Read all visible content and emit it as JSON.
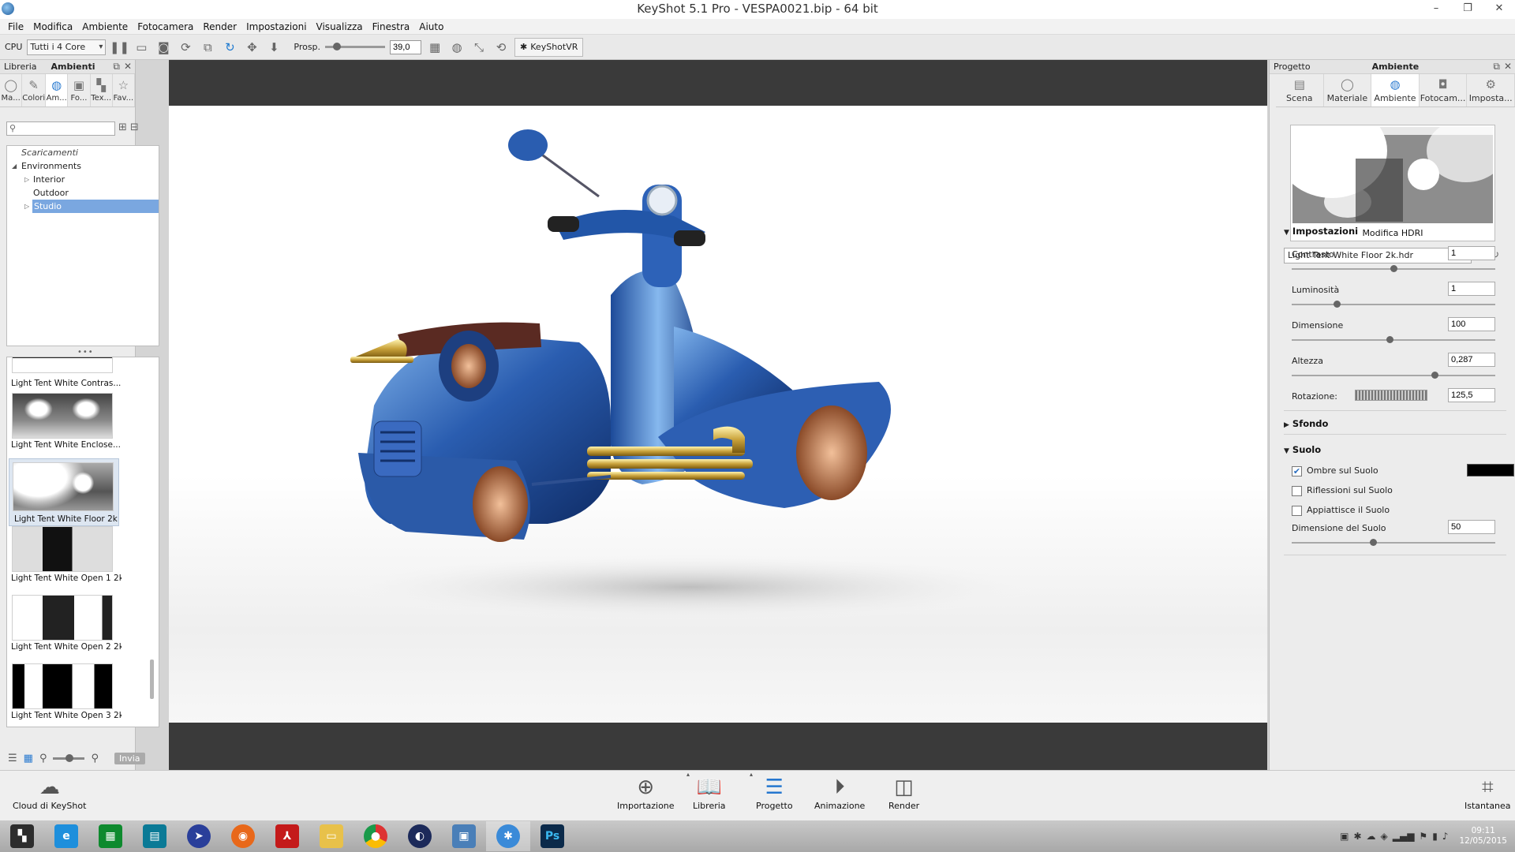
{
  "window": {
    "title": "KeyShot 5.1 Pro  - VESPA0021.bip  - 64 bit",
    "controls": [
      "–",
      "❐",
      "✕"
    ]
  },
  "menu": [
    "File",
    "Modifica",
    "Ambiente",
    "Fotocamera",
    "Render",
    "Impostazioni",
    "Visualizza",
    "Finestra",
    "Aiuto"
  ],
  "toolbar": {
    "cpu_label": "CPU",
    "cpu_value": "Tutti i 4 Core",
    "persp_label": "Prosp.",
    "persp_value": "39,0",
    "vr_label": "KeyShotVR"
  },
  "left_panel": {
    "tabs": [
      "Libreria",
      "Ambienti"
    ],
    "icon_tabs": [
      {
        "label": "Ma...",
        "icon": "material-icon"
      },
      {
        "label": "Colori",
        "icon": "colors-icon"
      },
      {
        "label": "Am...",
        "icon": "globe-icon"
      },
      {
        "label": "Fo...",
        "icon": "image-icon"
      },
      {
        "label": "Tex...",
        "icon": "texture-icon"
      },
      {
        "label": "Fav...",
        "icon": "star-icon"
      }
    ],
    "search_placeholder": "",
    "tree": {
      "downloads": "Scaricamenti",
      "root": "Environments",
      "items": [
        "Interior",
        "Outdoor",
        "Studio"
      ]
    },
    "thumbnails": [
      "Light Tent White Contras...",
      "Light Tent White Enclose...",
      "Light Tent White Floor 2k",
      "Light Tent White Open 1 2k",
      "Light Tent White Open 2 2k",
      "Light Tent White Open 3 2k"
    ],
    "send_button": "Invia"
  },
  "right_panel": {
    "tabs": [
      "Progetto",
      "Ambiente"
    ],
    "icon_tabs": [
      {
        "label": "Scena",
        "icon": "scene-icon"
      },
      {
        "label": "Materiale",
        "icon": "material-icon"
      },
      {
        "label": "Ambiente",
        "icon": "globe-icon"
      },
      {
        "label": "Fotocam...",
        "icon": "camera-icon"
      },
      {
        "label": "Imposta...",
        "icon": "gear-icon"
      }
    ],
    "hdri_caption": "Modifica HDRI",
    "hdri_file": "Light Tent White Floor 2k.hdr",
    "settings_title": "Impostazioni",
    "params": [
      {
        "label": "Contrasto",
        "value": "1",
        "slider": 0.5
      },
      {
        "label": "Luminosità",
        "value": "1",
        "slider": 0.22
      },
      {
        "label": "Dimensione",
        "value": "100",
        "slider": 0.48
      },
      {
        "label": "Altezza",
        "value": "0,287",
        "slider": 0.7
      }
    ],
    "rotation": {
      "label": "Rotazione:",
      "value": "125,5"
    },
    "background_title": "Sfondo",
    "ground_title": "Suolo",
    "ground_shadows": "Ombre sul Suolo",
    "ground_reflections": "Riflessioni sul Suolo",
    "ground_flatten": "Appiattisce il Suolo",
    "ground_size": {
      "label": "Dimensione del Suolo",
      "value": "50",
      "slider": 0.4
    },
    "shadow_color": "#000000"
  },
  "dock": {
    "cloud": "Cloud di KeyShot",
    "buttons": [
      "Importazione",
      "Libreria",
      "Progetto",
      "Animazione",
      "Render"
    ],
    "snapshot": "Istantanea"
  },
  "taskbar": {
    "clock_time": "09:11",
    "clock_date": "12/05/2015"
  },
  "colors": {
    "accent": "#2b7bd0",
    "selection": "#7aa7e0",
    "viewport_frame": "#3a3a3a",
    "scooter_body": "#2a5db0"
  }
}
